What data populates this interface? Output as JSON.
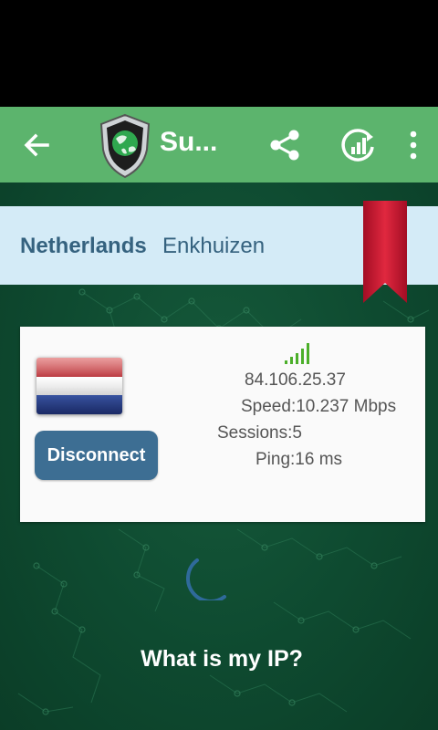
{
  "toolbar": {
    "title": "Su...",
    "back_icon": "arrow-left-icon",
    "logo_icon": "shield-globe-logo",
    "share_icon": "share-icon",
    "speedtest_icon": "speed-test-icon",
    "more_icon": "more-vert-icon"
  },
  "location": {
    "country": "Netherlands",
    "city": "Enkhuizen"
  },
  "server": {
    "flag": "netherlands-flag",
    "ip": "84.106.25.37",
    "speed": "Speed:10.237 Mbps",
    "sessions": "Sessions:5",
    "ping": "Ping:16 ms",
    "signal_bars": 5
  },
  "actions": {
    "disconnect_label": "Disconnect",
    "whats_my_ip_label": "What is my IP?"
  },
  "colors": {
    "toolbar": "#5cb46d",
    "background": "#0e4a30",
    "location_bar": "#d4ebf7",
    "button": "#3d6e93",
    "ribbon": "#c8102e",
    "signal": "#4caf2a"
  }
}
